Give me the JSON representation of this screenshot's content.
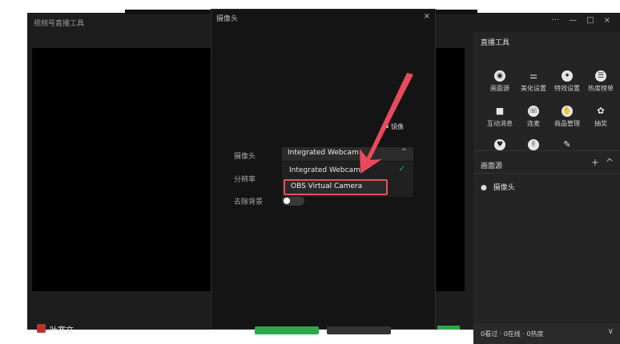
{
  "window": {
    "title": "视频号直播工具",
    "controls": [
      "···",
      "—",
      "□",
      "×"
    ]
  },
  "dialog": {
    "title": "摄像头",
    "close": "×",
    "mirror_label": "镜像",
    "camera_label": "摄像头",
    "resolution_label": "分辨率",
    "remove_bg_label": "去除背景",
    "selected_camera": "Integrated Webcam",
    "options": [
      {
        "label": "Integrated Webcam",
        "checked": true
      },
      {
        "label": "OBS Virtual Camera",
        "checked": false
      }
    ],
    "remove_bg_enabled": false
  },
  "tools": {
    "title": "直播工具",
    "items": [
      {
        "label": "画面源",
        "icon": "layers-icon",
        "glyph": "◉"
      },
      {
        "label": "美化设置",
        "icon": "sliders-icon",
        "glyph": "⚌"
      },
      {
        "label": "特效设置",
        "icon": "sparkle-icon",
        "glyph": "✦"
      },
      {
        "label": "热度榜单",
        "icon": "list-icon",
        "glyph": "☰"
      },
      {
        "label": "互动消息",
        "icon": "message-icon",
        "glyph": "■"
      },
      {
        "label": "连麦",
        "icon": "phone-icon",
        "glyph": "☏"
      },
      {
        "label": "商品管理",
        "icon": "bag-icon",
        "glyph": "✋"
      },
      {
        "label": "抽奖",
        "icon": "gift-icon",
        "glyph": "✿"
      },
      {
        "label": "",
        "icon": "heart-icon",
        "glyph": "♥"
      },
      {
        "label": "",
        "icon": "gesture-icon",
        "glyph": "✌"
      },
      {
        "label": "",
        "icon": "note-icon",
        "glyph": "✎"
      }
    ]
  },
  "scene": {
    "title": "画面源",
    "add": "+",
    "collapse": "^",
    "items": [
      {
        "label": "摄像头",
        "icon": "location-pin-icon"
      }
    ]
  },
  "stats": {
    "text": "0看过 · 0在线 · 0热度",
    "chevron": "∨"
  },
  "user": {
    "name": "叶寒文"
  },
  "colors": {
    "accent_green": "#2ba84a",
    "highlight_red": "#e8505b"
  }
}
